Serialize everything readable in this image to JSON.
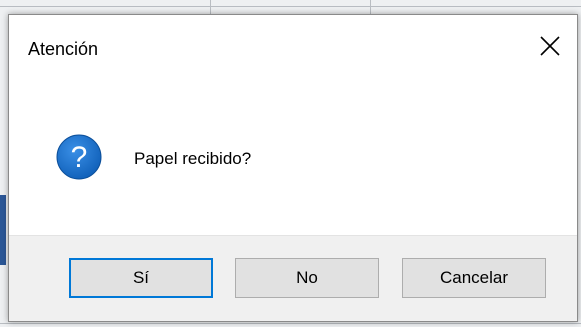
{
  "dialog": {
    "title": "Atención",
    "message": "Papel recibido?",
    "icon": "question-icon",
    "close_icon": "close-icon"
  },
  "buttons": {
    "yes_label": "Sí",
    "no_label": "No",
    "cancel_label": "Cancelar"
  },
  "colors": {
    "accent": "#0078d7",
    "icon_blue": "#1a6fc9",
    "button_face": "#e1e1e1",
    "footer_bg": "#f0f0f0"
  }
}
